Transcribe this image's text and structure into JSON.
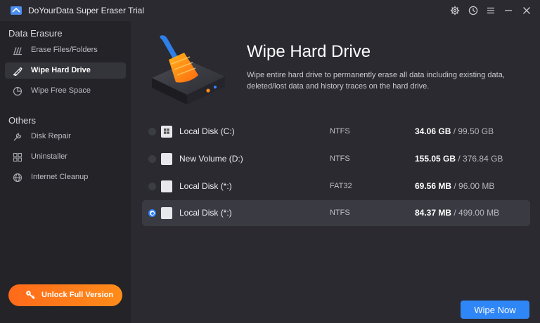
{
  "app": {
    "title": "DoYourData Super Eraser Trial"
  },
  "titlebar": {
    "icons": [
      "gear-icon",
      "clock-icon",
      "menu-icon",
      "minimize-icon",
      "close-icon"
    ]
  },
  "sidebar": {
    "section1_title": "Data Erasure",
    "section2_title": "Others",
    "items": [
      {
        "label": "Erase Files/Folders",
        "icon": "files-icon"
      },
      {
        "label": "Wipe Hard Drive",
        "icon": "drive-icon",
        "active": true
      },
      {
        "label": "Wipe Free Space",
        "icon": "pie-icon"
      },
      {
        "label": "Disk Repair",
        "icon": "wrench-icon"
      },
      {
        "label": "Uninstaller",
        "icon": "grid-icon"
      },
      {
        "label": "Internet Cleanup",
        "icon": "globe-icon"
      }
    ],
    "unlock_label": "Unlock Full Version"
  },
  "main": {
    "title": "Wipe Hard Drive",
    "description": "Wipe entire hard drive to permanently erase all data including existing data, deleted/lost data and history traces on the hard drive.",
    "disks": [
      {
        "name": "Local Disk (C:)",
        "fs": "NTFS",
        "used": "34.06 GB",
        "total": "/ 99.50 GB",
        "selected": false
      },
      {
        "name": "New Volume (D:)",
        "fs": "NTFS",
        "used": "155.05 GB",
        "total": "/ 376.84 GB",
        "selected": false
      },
      {
        "name": "Local Disk (*:)",
        "fs": "FAT32",
        "used": "69.56 MB",
        "total": "/ 96.00 MB",
        "selected": false
      },
      {
        "name": "Local Disk (*:)",
        "fs": "NTFS",
        "used": "84.37 MB",
        "total": "/ 499.00 MB",
        "selected": true
      }
    ],
    "wipe_label": "Wipe Now"
  },
  "colors": {
    "accent": "#2f86f6",
    "unlock": "#ff7a1a",
    "sidebar_bg": "#232328",
    "main_bg": "#2a2a30"
  }
}
